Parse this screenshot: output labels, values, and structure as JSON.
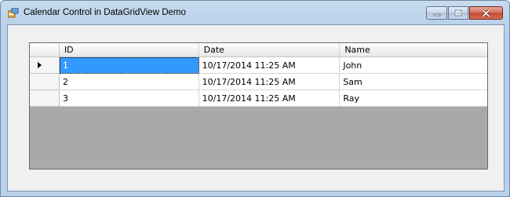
{
  "window": {
    "title": "Calendar Control in DataGridView Demo",
    "colors": {
      "frame": "#b9d1ea",
      "selection": "#3399ff",
      "grid_background": "#a9a9a9"
    }
  },
  "grid": {
    "columns": [
      "ID",
      "Date",
      "Name"
    ],
    "rows": [
      {
        "id": "1",
        "date": "10/17/2014 11:25 AM",
        "name": "John",
        "current": true
      },
      {
        "id": "2",
        "date": "10/17/2014 11:25 AM",
        "name": "Sam",
        "current": false
      },
      {
        "id": "3",
        "date": "10/17/2014 11:25 AM",
        "name": "Ray",
        "current": false
      }
    ]
  }
}
